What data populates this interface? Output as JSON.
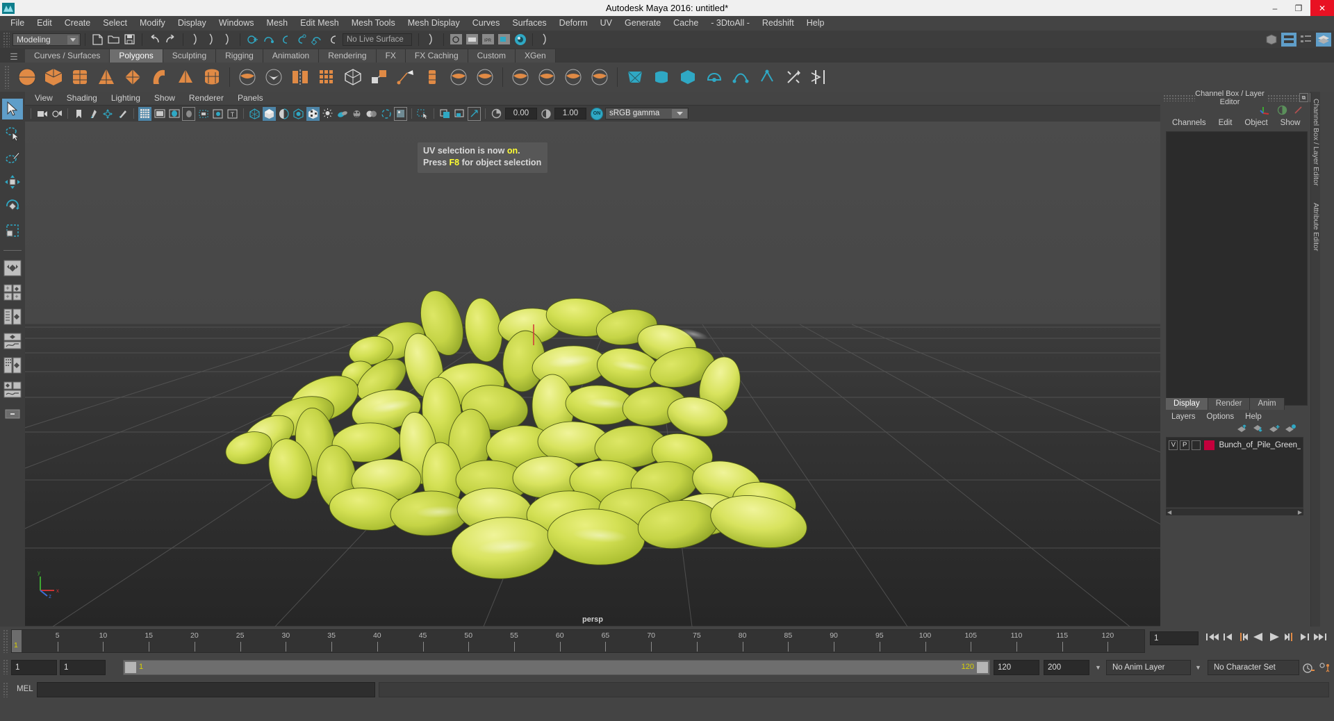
{
  "window": {
    "title": "Autodesk Maya 2016: untitled*",
    "logo_icon": "maya-logo-icon",
    "buttons": [
      {
        "name": "minimize",
        "glyph": "–"
      },
      {
        "name": "maximize",
        "glyph": "❐"
      },
      {
        "name": "close",
        "glyph": "✕"
      }
    ]
  },
  "menubar": {
    "items": [
      "File",
      "Edit",
      "Create",
      "Select",
      "Modify",
      "Display",
      "Windows",
      "Mesh",
      "Edit Mesh",
      "Mesh Tools",
      "Mesh Display",
      "Curves",
      "Surfaces",
      "Deform",
      "UV",
      "Generate",
      "Cache",
      "- 3DtoAll -",
      "Redshift",
      "Help"
    ]
  },
  "statusline": {
    "mode": "Modeling",
    "live_surface": "No Live Surface",
    "icons": [
      "new-scene-icon",
      "open-scene-icon",
      "save-scene-icon",
      "undo-icon",
      "redo-icon",
      "select-by-hierarchy-icon",
      "select-by-object-icon",
      "select-by-component-icon",
      "snap-to-grid-icon",
      "snap-to-curve-icon",
      "snap-to-point-icon",
      "snap-to-projected-center-icon",
      "snap-to-view-plane-icon",
      "make-live-icon"
    ],
    "right_icons": [
      "show-hide-modeling-toolkit-icon",
      "show-hide-attribute-editor-icon",
      "show-hide-tool-settings-icon",
      "show-hide-channel-box-icon"
    ]
  },
  "shelf": {
    "tabs": [
      "Curves / Surfaces",
      "Polygons",
      "Sculpting",
      "Rigging",
      "Animation",
      "Rendering",
      "FX",
      "FX Caching",
      "Custom",
      "XGen"
    ],
    "active_tab": "Polygons",
    "overflow_icon": "shelf-menu-icon",
    "icons": [
      "poly-sphere-icon",
      "poly-cube-icon",
      "poly-cylinder-icon",
      "poly-cone-icon",
      "poly-plane-icon",
      "poly-torus-icon",
      "poly-pyramid-icon",
      "poly-pipe-icon",
      "poly-combine-icon",
      "poly-separate-icon",
      "poly-mirror-icon",
      "poly-smooth-icon",
      "poly-reduce-icon",
      "poly-booleans-icon",
      "poly-extrude-icon",
      "poly-bevel-icon",
      "poly-bridge-icon",
      "poly-append-icon",
      "poly-sculpt-icon",
      "poly-quad-draw-icon",
      "poly-multicut-icon",
      "poly-target-weld-icon",
      "uv-planar-icon",
      "uv-cylindrical-icon",
      "uv-spherical-icon",
      "uv-automatic-icon",
      "uv-editor-icon",
      "uv-layout-icon",
      "uv-cut-icon",
      "uv-sew-icon"
    ]
  },
  "toolbox": {
    "items": [
      {
        "name": "select-tool",
        "icon": "arrow-cursor-icon",
        "selected": true
      },
      {
        "name": "lasso-tool",
        "icon": "lasso-select-icon",
        "selected": false
      },
      {
        "name": "paint-select-tool",
        "icon": "paint-brush-select-icon",
        "selected": false
      },
      {
        "name": "move-tool",
        "icon": "move-arrows-icon",
        "selected": false
      },
      {
        "name": "rotate-tool",
        "icon": "rotate-circle-icon",
        "selected": false
      },
      {
        "name": "scale-tool",
        "icon": "scale-box-icon",
        "selected": false
      }
    ],
    "layouts": [
      {
        "name": "single-perspective-view",
        "icon": "layout-single-icon"
      },
      {
        "name": "four-view-layout",
        "icon": "layout-four-icon"
      },
      {
        "name": "outliner-persp-layout",
        "icon": "layout-outliner-persp-icon"
      },
      {
        "name": "persp-graph-layout",
        "icon": "layout-persp-graph-icon"
      },
      {
        "name": "hypershade-persp-layout",
        "icon": "layout-hypershade-persp-icon"
      },
      {
        "name": "persp-trax-layout",
        "icon": "layout-persp-trax-icon"
      },
      {
        "name": "minimize-layout",
        "icon": "layout-minimize-icon"
      }
    ]
  },
  "viewport": {
    "menu": [
      "View",
      "Shading",
      "Lighting",
      "Show",
      "Renderer",
      "Panels"
    ],
    "toolbar": {
      "icons": [
        "select-camera-icon",
        "camera-attributes-icon",
        "bookmark-icon",
        "image-plane-icon",
        "2d-pan-zoom-icon",
        "grease-pencil-icon",
        "grid-icon",
        "film-gate-icon",
        "resolution-gate-icon",
        "gate-mask-icon",
        "film-origin-icon",
        "safe-action-icon",
        "safe-title-icon",
        "wireframe-icon",
        "smooth-shade-all-icon",
        "shade-wireframe-icon",
        "use-default-material-icon",
        "textured-icon",
        "use-all-lights-icon",
        "shadows-icon",
        "screen-space-ao-icon",
        "motion-blur-icon",
        "multisample-icon",
        "isolate-select-icon",
        "xray-icon",
        "xray-joints-icon",
        "xray-active-components-icon",
        "exposure-icon",
        "gamma-icon"
      ],
      "exposure_value": "0.00",
      "gamma_value": "1.00",
      "color_management_toggle": "ON",
      "color_profile": "sRGB gamma"
    },
    "camera_label": "persp",
    "axis_labels": [
      "y",
      "x",
      "z"
    ],
    "tooltip": {
      "line1_pre": "UV selection is now ",
      "line1_hi": "on",
      "line1_post": ".",
      "line2_pre": "Press ",
      "line2_hi": "F8",
      "line2_post": " for object selection"
    }
  },
  "right_panel": {
    "title": "Channel Box / Layer Editor",
    "header_buttons": [
      "undock-icon",
      "close-icon"
    ],
    "quick_icons": [
      "axis-gizmo-icon",
      "half-circle-icon",
      "slash-icon"
    ],
    "channelbox_menu": [
      "Channels",
      "Edit",
      "Object",
      "Show"
    ],
    "side_label": "Channel Box / Layer Editor",
    "side_label2": "Attribute Editor",
    "layer_tabs": [
      "Display",
      "Render",
      "Anim"
    ],
    "layer_active_tab": "Display",
    "layer_menu": [
      "Layers",
      "Options",
      "Help"
    ],
    "layer_buttons": [
      "move-layer-up-icon",
      "move-layer-down-icon",
      "new-layer-icon",
      "new-layer-from-selected-icon"
    ],
    "layers": [
      {
        "visible": "V",
        "playback": "P",
        "type": "",
        "color": "#c4003c",
        "name": "Bunch_of_Pile_Green_So"
      }
    ]
  },
  "timeslider": {
    "ticks": [
      5,
      10,
      15,
      20,
      25,
      30,
      35,
      40,
      45,
      50,
      55,
      60,
      65,
      70,
      75,
      80,
      85,
      90,
      95,
      100,
      105,
      110,
      115,
      120
    ],
    "current_frame": "1",
    "current_frame_field": "1",
    "transport": [
      "go-to-start-icon",
      "step-back-frame-icon",
      "step-back-key-icon",
      "play-backwards-icon",
      "play-forwards-icon",
      "step-forward-key-icon",
      "step-forward-frame-icon",
      "go-to-end-icon"
    ]
  },
  "rangeslider": {
    "anim_start": "1",
    "range_start": "1",
    "bar_label": "1",
    "bar_end_label": "120",
    "range_end": "120",
    "anim_end": "200",
    "anim_layer": "No Anim Layer",
    "character_set": "No Character Set",
    "right_icons": [
      "auto-key-icon",
      "animation-preferences-icon"
    ]
  },
  "commandline": {
    "label": "MEL",
    "input_value": "",
    "output_value": ""
  },
  "colors": {
    "accent_blue": "#5f9ec9",
    "shelf_orange": "#e08a45",
    "teal": "#2fa8c4",
    "highlight_yellow": "#ffff33",
    "layer_red": "#c4003c",
    "object_green": "#cfdc4a"
  }
}
